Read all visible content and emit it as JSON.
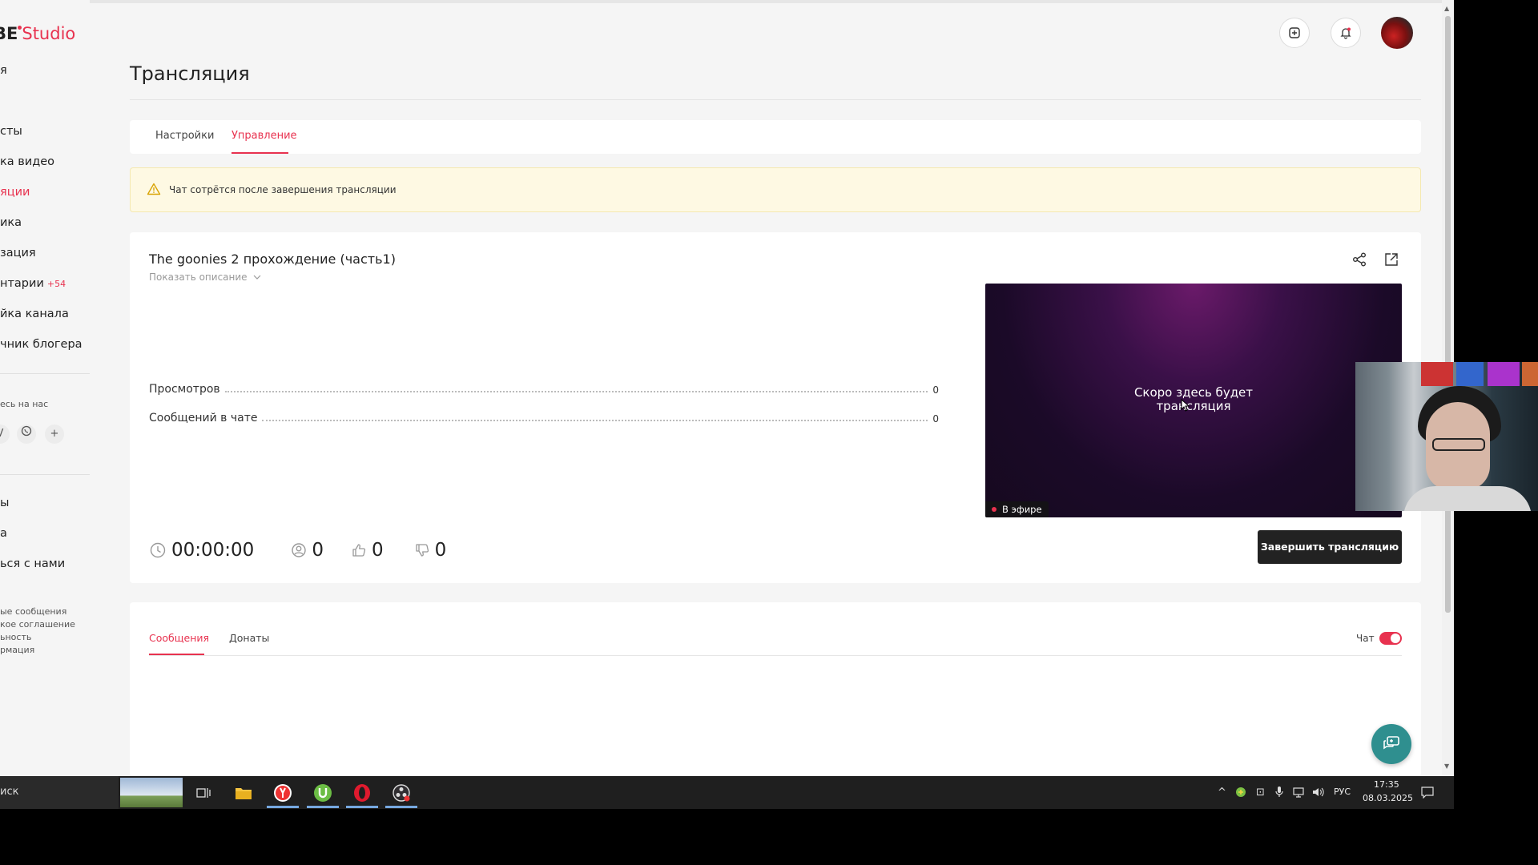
{
  "brand": {
    "logo_dark": "BE",
    "logo_red": "Studio"
  },
  "sidebar": {
    "items": [
      {
        "label": "я"
      },
      {
        "label": "сты"
      },
      {
        "label": "ка видео"
      },
      {
        "label": "яции",
        "active": true
      },
      {
        "label": "ика"
      },
      {
        "label": "зация"
      },
      {
        "label": "нтарии",
        "badge": "+54"
      },
      {
        "label": "йка канала"
      },
      {
        "label": "чник блогера"
      }
    ],
    "follow_label": "есь на нас",
    "secondary": [
      "ы",
      "а",
      "ься с нами"
    ],
    "footer": [
      "ые сообщения",
      "кое соглашение",
      "ьность",
      "рмация"
    ]
  },
  "page": {
    "title": "Трансляция"
  },
  "tabs": {
    "settings": "Настройки",
    "manage": "Управление"
  },
  "alert": {
    "text": "Чат сотрётся после завершения трансляции"
  },
  "stream": {
    "title": "The goonies 2 прохождение (часть1)",
    "show_description": "Показать описание",
    "stats": [
      {
        "label": "Просмотров",
        "value": "0"
      },
      {
        "label": "Сообщений в чате",
        "value": "0"
      }
    ],
    "duration": "00:00:00",
    "viewers": "0",
    "likes": "0",
    "dislikes": "0",
    "video_text_line1": "Скоро здесь будет",
    "video_text_line2": "трансляция",
    "live_label": "В эфире",
    "end_button": "Завершить трансляцию"
  },
  "messages": {
    "tab_messages": "Сообщения",
    "tab_donations": "Донаты",
    "chat_label": "Чат",
    "chat_enabled": true
  },
  "taskbar": {
    "search_text": "иск",
    "lang": "РУС",
    "time": "17:35",
    "date": "08.03.2025"
  },
  "colors": {
    "accent": "#e8324f",
    "dark_button": "#222222",
    "alert_bg": "#fef9e3",
    "fab": "#2f8f8f"
  }
}
